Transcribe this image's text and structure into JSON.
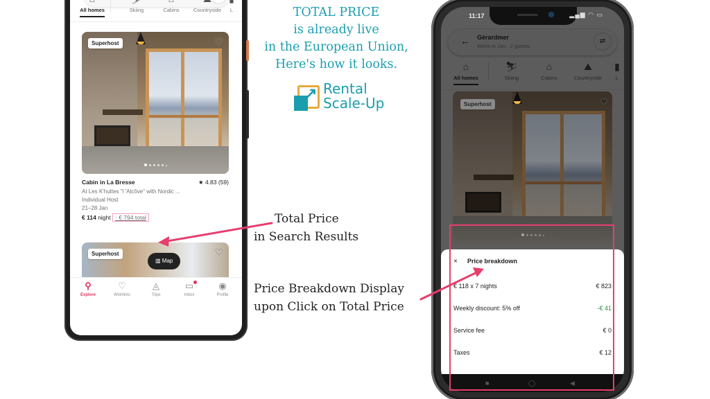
{
  "headline": {
    "lines": [
      "TOTAL PRICE",
      "is already live",
      "in the European Union,",
      "Here's how it looks."
    ],
    "color": "#1a9eae"
  },
  "logo": {
    "line1": "Rental",
    "line2": "Scale-Up",
    "icon": "expand-arrow-icon"
  },
  "annotations": {
    "search_results": [
      "Total Price",
      "in Search Results"
    ],
    "price_breakdown": [
      "Price Breakdown Display",
      "upon Click on Total Price"
    ],
    "arrow_color": "#e83d6c"
  },
  "left_phone": {
    "search": {
      "subtitle": "Week in Jan · 2 guests"
    },
    "categories": [
      {
        "label": "All homes",
        "icon": "homes-icon",
        "glyph": "⌂",
        "active": true
      },
      {
        "label": "Skiing",
        "icon": "skiing-icon",
        "glyph": "⛷",
        "active": false
      },
      {
        "label": "Cabins",
        "icon": "cabin-icon",
        "glyph": "⌂",
        "active": false
      },
      {
        "label": "Countryside",
        "icon": "countryside-icon",
        "glyph": "⛰",
        "active": false
      },
      {
        "label": "L",
        "icon": "more-icon",
        "glyph": "▮",
        "active": false
      }
    ],
    "listing": {
      "badge": "Superhost",
      "heart": "♡",
      "title": "Cabin in La Bresse",
      "rating": "★ 4.83 (59)",
      "description": "At Les K'huttes \"l 'Alcôve\" with Nordic ...",
      "host": "Individual Host",
      "dates": "21–28 Jan",
      "night_price": "€ 114",
      "night_label": "night",
      "separator": "·",
      "total_price": "€ 794 total",
      "photo_count": 6,
      "photo_index": 1
    },
    "listing2": {
      "badge": "Superhost",
      "heart": "♡"
    },
    "map_button": {
      "icon": "▥",
      "label": "Map"
    },
    "tabs": [
      {
        "label": "Explore",
        "icon": "search-icon",
        "glyph": "⚲",
        "active": true
      },
      {
        "label": "Wishlists",
        "icon": "heart-icon",
        "glyph": "♡",
        "active": false
      },
      {
        "label": "Trips",
        "icon": "airbnb-icon",
        "glyph": "◬",
        "active": false
      },
      {
        "label": "Inbox",
        "icon": "message-icon",
        "glyph": "▭",
        "active": false,
        "badge": true
      },
      {
        "label": "Profile",
        "icon": "profile-icon",
        "glyph": "◉",
        "active": false
      }
    ]
  },
  "right_phone": {
    "status": {
      "time": "11:17",
      "icons": "▂▄▆ ◠ ▭"
    },
    "search": {
      "back": "←",
      "title": "Gérardmer",
      "subtitle": "Week in Jan · 2 guests",
      "filter": "⇄"
    },
    "categories": [
      {
        "label": "All homes",
        "glyph": "⌂",
        "active": true
      },
      {
        "label": "Skiing",
        "glyph": "⛷",
        "active": false
      },
      {
        "label": "Cabins",
        "glyph": "⌂",
        "active": false
      },
      {
        "label": "Countryside",
        "glyph": "⛰",
        "active": false
      },
      {
        "label": "L",
        "glyph": "▮",
        "active": false
      }
    ],
    "listing": {
      "badge": "Superhost",
      "heart": "♥"
    },
    "price_breakdown": {
      "close": "×",
      "title": "Price breakdown",
      "rows": [
        {
          "label": "€ 118 x 7 nights",
          "value": "€ 823",
          "negative": false
        },
        {
          "label": "Weekly discount: 5% off",
          "value": "-€ 41",
          "negative": true
        },
        {
          "label": "Service fee",
          "value": "€ 0",
          "negative": false
        },
        {
          "label": "Taxes",
          "value": "€ 12",
          "negative": false
        }
      ]
    },
    "navbar": {
      "recent": "■",
      "home": "◯",
      "back": "◀"
    }
  }
}
